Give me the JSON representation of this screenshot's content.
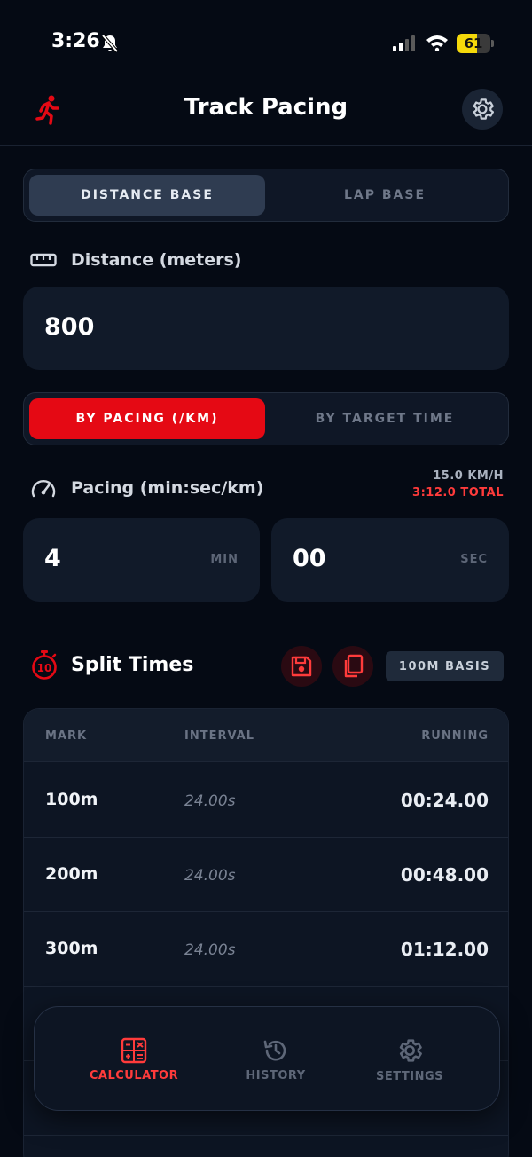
{
  "status_bar": {
    "time": "3:26",
    "battery": "61",
    "battery_level": 0.61
  },
  "header": {
    "title": "Track Pacing"
  },
  "distance_mode": {
    "options": [
      "DISTANCE BASE",
      "LAP BASE"
    ],
    "active": 0
  },
  "distance": {
    "label": "Distance (meters)",
    "value": "800"
  },
  "calc_mode": {
    "options": [
      "BY PACING (/KM)",
      "BY TARGET TIME"
    ],
    "active": 0
  },
  "pacing": {
    "label": "Pacing (min:sec/km)",
    "speed": "15.0 KM/H",
    "total": "3:12.0 TOTAL",
    "minutes": "4",
    "minutes_unit": "MIN",
    "seconds": "00",
    "seconds_unit": "SEC"
  },
  "splits": {
    "title": "Split Times",
    "basis": "100M BASIS",
    "columns": [
      "MARK",
      "INTERVAL",
      "RUNNING"
    ],
    "rows": [
      {
        "mark": "100m",
        "interval": "24.00s",
        "running": "00:24.00"
      },
      {
        "mark": "200m",
        "interval": "24.00s",
        "running": "00:48.00"
      },
      {
        "mark": "300m",
        "interval": "24.00s",
        "running": "01:12.00"
      }
    ]
  },
  "nav": {
    "items": [
      "CALCULATOR",
      "HISTORY",
      "SETTINGS"
    ],
    "active": 0
  },
  "colors": {
    "accent": "#e50914",
    "accent_text": "#ff3b3b",
    "background": "#050a14",
    "card": "#111a29"
  }
}
